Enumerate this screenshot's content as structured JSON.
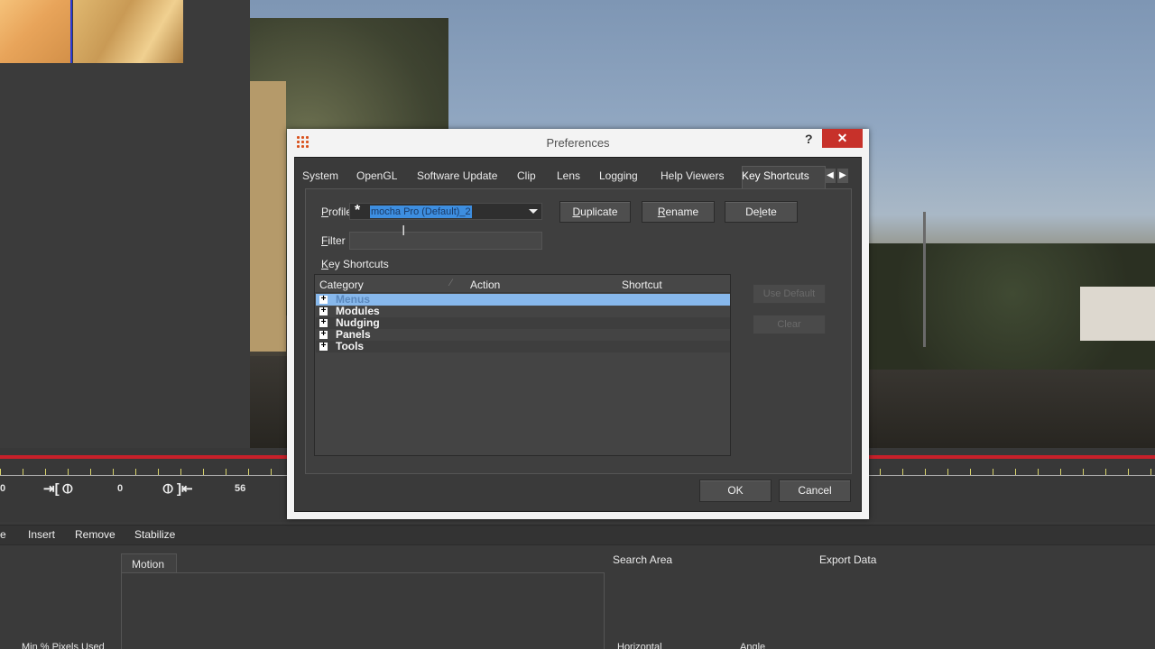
{
  "timeline": {
    "frame_left": "0",
    "frame_current": "0",
    "frame_out": "56",
    "marker_in_icon": "in-point-icon",
    "marker_out_icon": "out-point-icon"
  },
  "module_tabs": [
    "e",
    "Insert",
    "Remove",
    "Stabilize"
  ],
  "bottom_panel": {
    "motion_tab": "Motion",
    "search_area": "Search Area",
    "export_data": "Export Data",
    "min_pixels": "Min % Pixels Used",
    "horizontal": "Horizontal",
    "angle": "Angle"
  },
  "dialog": {
    "title": "Preferences",
    "help": "?",
    "close": "✕",
    "tabs": [
      "System",
      "OpenGL",
      "Software Update",
      "Clip",
      "Lens",
      "Logging",
      "Help Viewers",
      "Key Shortcuts"
    ],
    "active_tab": "Key Shortcuts",
    "profile_label": "Profile",
    "profile_marker": "*",
    "profile_value": "mocha Pro (Default)_2",
    "duplicate": "Duplicate",
    "rename": "Rename",
    "delete": "Delete",
    "filter_label": "Filter",
    "filter_value": "",
    "key_shortcuts_label": "Key Shortcuts",
    "columns": [
      "Category",
      "Action",
      "Shortcut"
    ],
    "rows": [
      "Menus",
      "Modules",
      "Nudging",
      "Panels",
      "Tools"
    ],
    "use_default": "Use Default",
    "clear": "Clear",
    "ok": "OK",
    "cancel": "Cancel"
  },
  "colors": {
    "dialog_bg": "#3a3a3a",
    "selection": "#87b8ec",
    "close_button": "#c7312a",
    "timeline_red": "#c8202a"
  }
}
